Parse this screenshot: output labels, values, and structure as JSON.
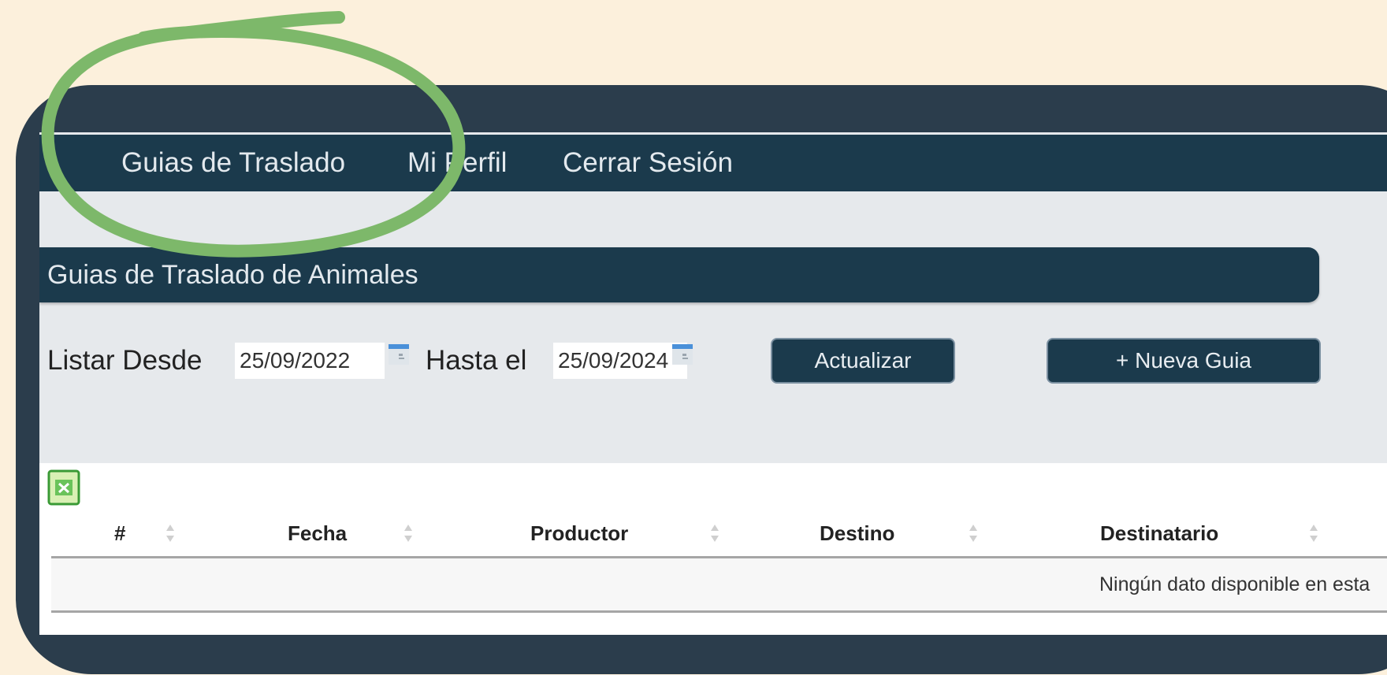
{
  "navbar": {
    "items": [
      {
        "label": "Guias de Traslado"
      },
      {
        "label": "Mi Perfil"
      },
      {
        "label": "Cerrar Sesión"
      }
    ]
  },
  "page": {
    "title": "Guias de Traslado de Animales"
  },
  "filters": {
    "from_label": "Listar Desde",
    "from_value": "25/09/2022",
    "to_label": "Hasta el",
    "to_value": "25/09/2024"
  },
  "actions": {
    "update_label": "Actualizar",
    "new_label": "+ Nueva Guia"
  },
  "table": {
    "columns": [
      "#",
      "Fecha",
      "Productor",
      "Destino",
      "Destinatario"
    ],
    "empty_message": "Ningún dato disponible en esta"
  },
  "colors": {
    "page_background": "#fcf0dc",
    "frame": "#2b3d4c",
    "navbar": "#1b3a4c",
    "annotation_circle": "#7db86a",
    "excel_green": "#3a9a35"
  },
  "icons": [
    "calendar-icon",
    "excel-export-icon",
    "sort-icon"
  ],
  "annotation": {
    "type": "hand-drawn circle",
    "target": "Guias de Traslado"
  }
}
